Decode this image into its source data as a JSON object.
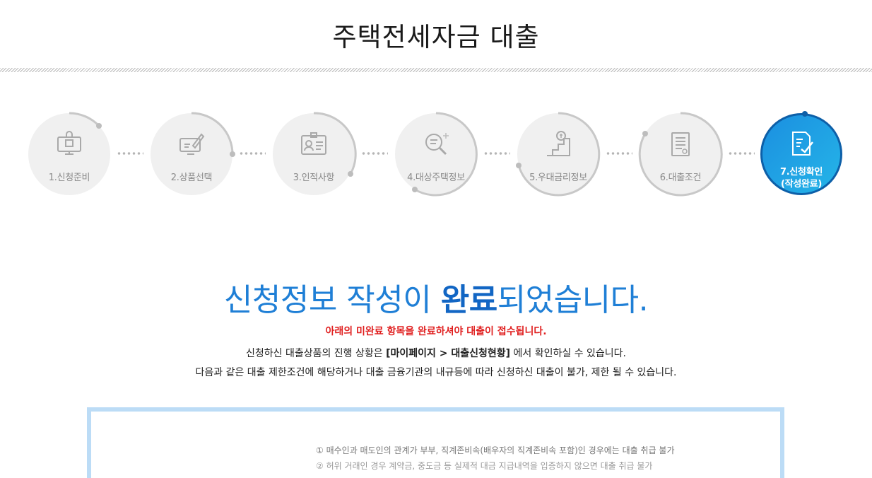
{
  "header": {
    "title": "주택전세자금 대출"
  },
  "steps": [
    {
      "label": "1.신청준비",
      "icon": "monitor-lock-icon"
    },
    {
      "label": "2.상품선택",
      "icon": "monitor-pen-icon"
    },
    {
      "label": "3.인적사항",
      "icon": "id-card-icon"
    },
    {
      "label": "4.대상주택정보",
      "icon": "magnifier-icon"
    },
    {
      "label": "5.우대금리정보",
      "icon": "stairs-coin-icon"
    },
    {
      "label": "6.대출조건",
      "icon": "document-icon"
    },
    {
      "label_line1": "7.신청확인",
      "label_line2": "(작성완료)",
      "icon": "checklist-icon"
    }
  ],
  "main": {
    "headline_pre": "신청정보 작성이 ",
    "headline_bold": "완료",
    "headline_post": "되었습니다.",
    "notice": "아래의 미완료 항목을 완료하셔야 대출이 접수됩니다.",
    "info1_pre": "신청하신 대출상품의 진행 상황은 ",
    "info1_bold": "[마이페이지 > 대출신청현황]",
    "info1_post": " 에서 확인하실 수 있습니다.",
    "info2": "다음과 같은 대출 제한조건에 해당하거나 대출 금융기관의 내규등에 따라 신청하신 대출이 불가, 제한 될 수 있습니다."
  },
  "conditions": [
    "① 매수인과 매도인의 관계가 부부, 직계존비속(배우자의 직계존비속 포함)인 경우에는 대출 취급 불가",
    "② 허위 거래인 경우 계약금, 중도금 등 실제적 대금 지급내역을 입증하지 않으면 대출 취급 불가"
  ],
  "colors": {
    "accent": "#1f7fd6",
    "active_dark": "#0d5fa8",
    "notice": "#e01f1f",
    "box_border": "#bcdcf6"
  }
}
